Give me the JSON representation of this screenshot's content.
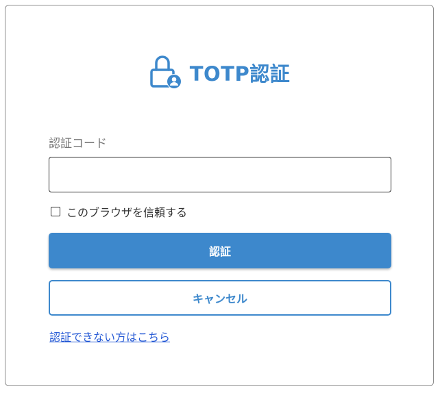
{
  "header": {
    "title": "TOTP認証",
    "icon": "lock-user-icon",
    "accent_color": "#3d88cc"
  },
  "form": {
    "code_label": "認証コード",
    "code_value": "",
    "remember_label": "このブラウザを信頼する",
    "remember_checked": false
  },
  "actions": {
    "submit_label": "認証",
    "cancel_label": "キャンセル"
  },
  "help": {
    "link_text": "認証できない方はこちら",
    "link_color": "#2a5dd6"
  }
}
